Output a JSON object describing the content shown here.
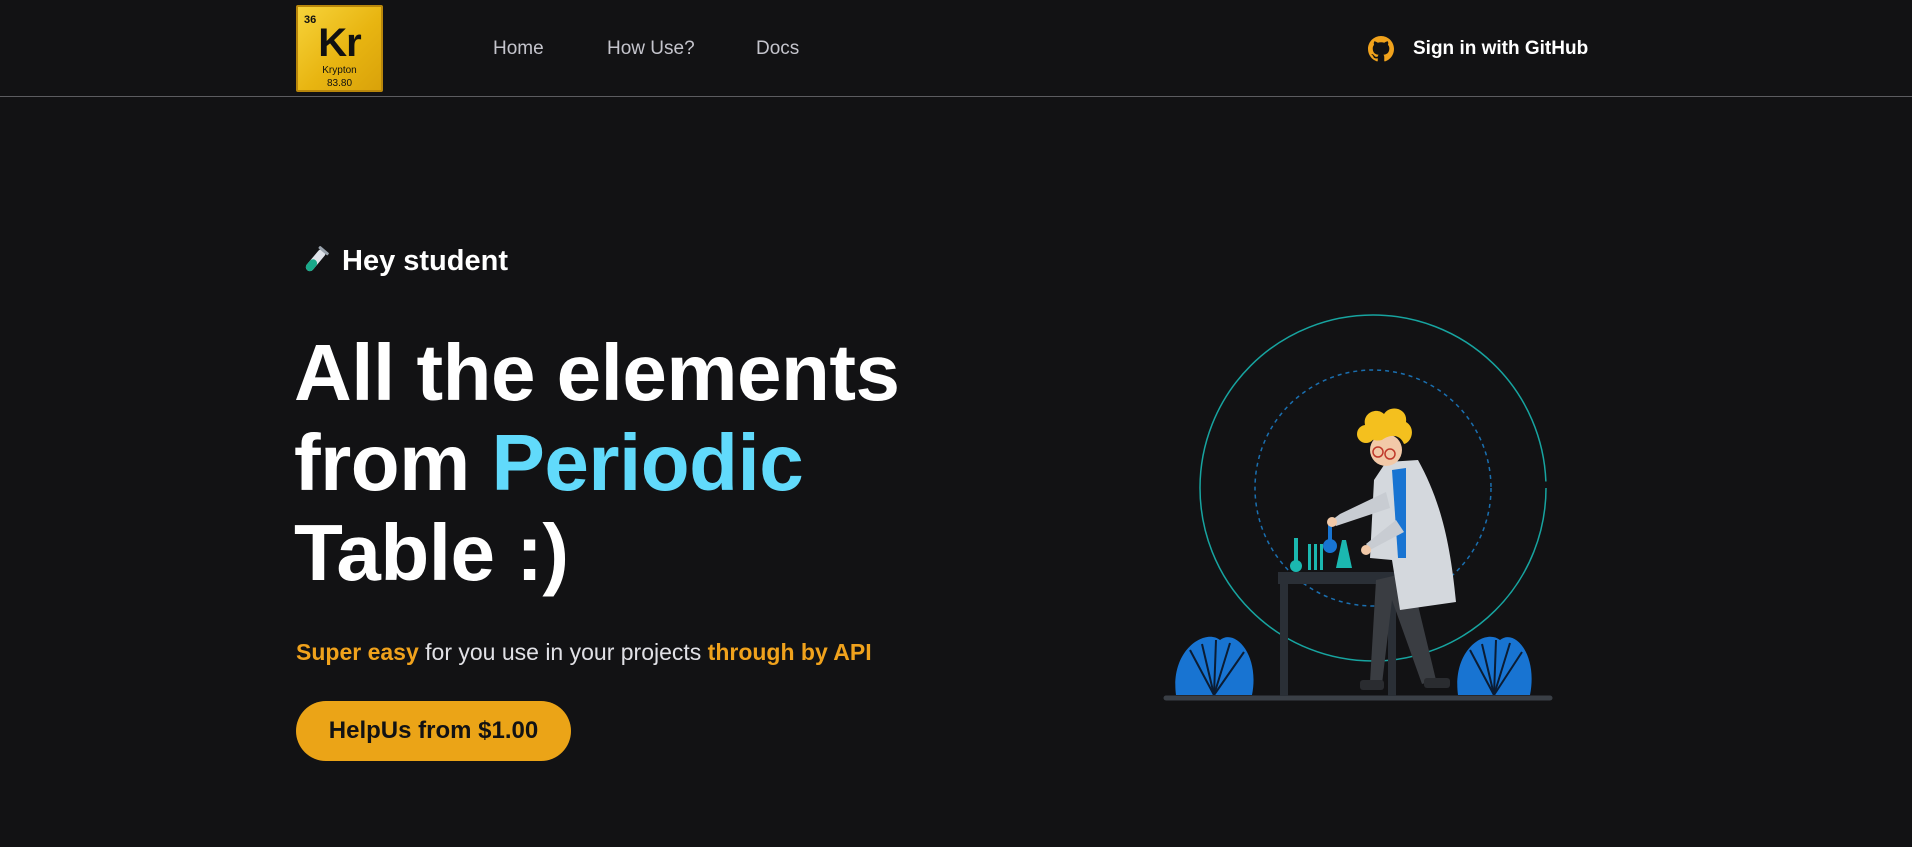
{
  "logo": {
    "atomic_number": "36",
    "symbol": "Kr",
    "name": "Krypton",
    "mass": "83.80"
  },
  "nav": {
    "home": "Home",
    "how_use": "How Use?",
    "docs": "Docs"
  },
  "auth": {
    "signin_label": "Sign in with GitHub",
    "icon": "github-icon"
  },
  "hero": {
    "eyebrow_icon": "test-tube-icon",
    "eyebrow": "Hey student",
    "headline_part1": "All the elements",
    "headline_part2": "from",
    "headline_accent": "Periodic",
    "headline_part3": "Table :)",
    "sub_hl1": "Super easy",
    "sub_mid": " for you use in your projects ",
    "sub_hl2": "through by API",
    "cta_label": "HelpUs from $1.00",
    "illustration": "scientist-illustration"
  },
  "colors": {
    "background": "#121214",
    "accent_blue": "#61dafb",
    "accent_orange": "#f0a21c",
    "button": "#eba417",
    "logo_gold": "#e8b511"
  }
}
